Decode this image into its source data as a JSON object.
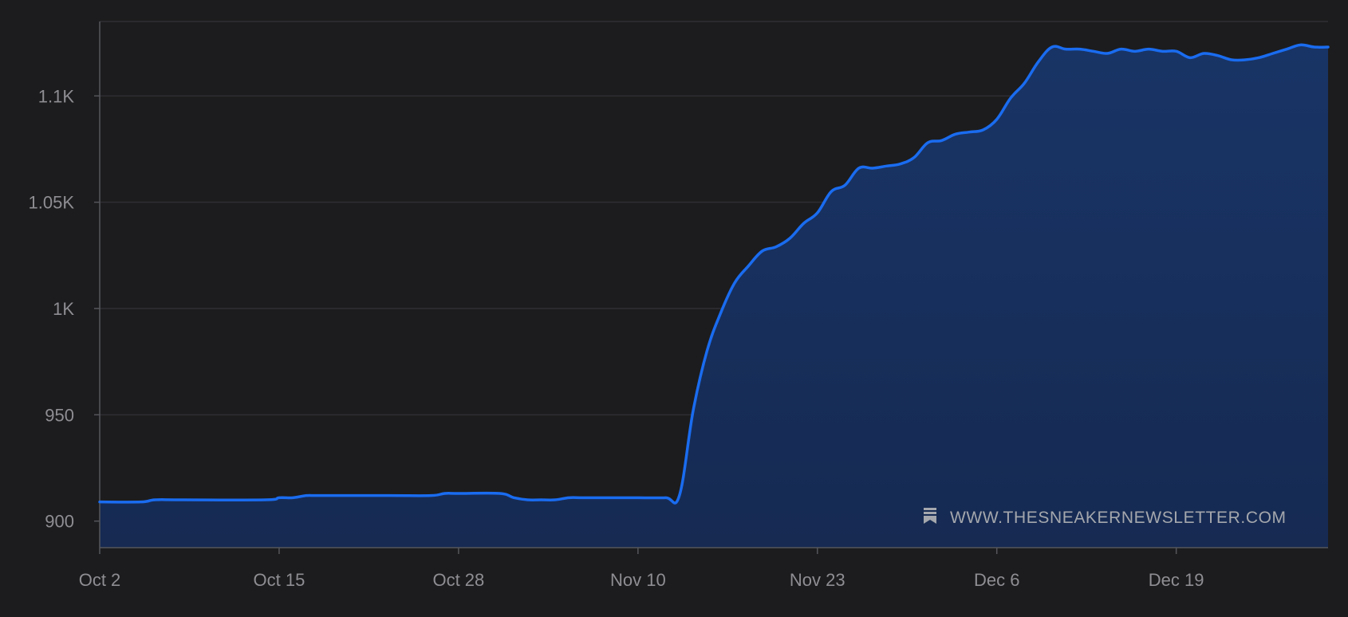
{
  "watermark": {
    "text": "WWW.THESNEAKERNEWSLETTER.COM",
    "icon": "bookmark-icon"
  },
  "colors": {
    "background": "#1c1c1e",
    "grid": "#2f2f33",
    "axis": "#55565b",
    "tick_label": "#8e8e93",
    "line": "#1a6cf0",
    "area_top": "#183466",
    "area_bottom": "#162a52",
    "watermark": "#a4a7ad"
  },
  "chart_data": {
    "type": "area",
    "title": "",
    "xlabel": "",
    "ylabel": "",
    "x_ticks": [
      "Oct 2",
      "Oct 15",
      "Oct 28",
      "Nov 10",
      "Nov 23",
      "Dec 6",
      "Dec 19"
    ],
    "y_ticks": [
      {
        "value": 900,
        "label": "900"
      },
      {
        "value": 950,
        "label": "950"
      },
      {
        "value": 1000,
        "label": "1K"
      },
      {
        "value": 1050,
        "label": "1.05K"
      },
      {
        "value": 1100,
        "label": "1.1K"
      }
    ],
    "ylim": [
      887.5,
      1135
    ],
    "xlim": [
      "2023-10-02",
      "2023-12-30"
    ],
    "grid": true,
    "legend": "none",
    "series": [
      {
        "dates": [
          "2023-10-02",
          "2023-10-05",
          "2023-10-06",
          "2023-10-08",
          "2023-10-14",
          "2023-10-15",
          "2023-10-16",
          "2023-10-17",
          "2023-10-18",
          "2023-10-23",
          "2023-10-26",
          "2023-10-27",
          "2023-10-28",
          "2023-10-31",
          "2023-11-01",
          "2023-11-02",
          "2023-11-03",
          "2023-11-04",
          "2023-11-05",
          "2023-11-06",
          "2023-11-08",
          "2023-11-10",
          "2023-11-12",
          "2023-11-13",
          "2023-11-14",
          "2023-11-15",
          "2023-11-16",
          "2023-11-17",
          "2023-11-18",
          "2023-11-19",
          "2023-11-20",
          "2023-11-21",
          "2023-11-22",
          "2023-11-23",
          "2023-11-24",
          "2023-11-25",
          "2023-11-26",
          "2023-11-27",
          "2023-11-28",
          "2023-11-29",
          "2023-11-30",
          "2023-12-01",
          "2023-12-02",
          "2023-12-03",
          "2023-12-04",
          "2023-12-05",
          "2023-12-06",
          "2023-12-07",
          "2023-12-08",
          "2023-12-09",
          "2023-12-10",
          "2023-12-11",
          "2023-12-12",
          "2023-12-13",
          "2023-12-14",
          "2023-12-15",
          "2023-12-16",
          "2023-12-17",
          "2023-12-18",
          "2023-12-19",
          "2023-12-20",
          "2023-12-21",
          "2023-12-22",
          "2023-12-23",
          "2023-12-24",
          "2023-12-25",
          "2023-12-26",
          "2023-12-27",
          "2023-12-28",
          "2023-12-29",
          "2023-12-30"
        ],
        "values": [
          909,
          909,
          910,
          910,
          910,
          911,
          911,
          912,
          912,
          912,
          912,
          913,
          913,
          913,
          911,
          910,
          910,
          910,
          911,
          911,
          911,
          911,
          911,
          912,
          952,
          980,
          998,
          1012,
          1020,
          1027,
          1029,
          1033,
          1040,
          1045,
          1055,
          1058,
          1066,
          1066,
          1067,
          1068,
          1071,
          1078,
          1079,
          1082,
          1083,
          1084,
          1089,
          1099,
          1106,
          1116,
          1123,
          1122,
          1122,
          1121,
          1120,
          1122,
          1121,
          1122,
          1121,
          1121,
          1118,
          1120,
          1119,
          1117,
          1117,
          1118,
          1120,
          1122,
          1124,
          1123,
          1123
        ]
      }
    ]
  }
}
